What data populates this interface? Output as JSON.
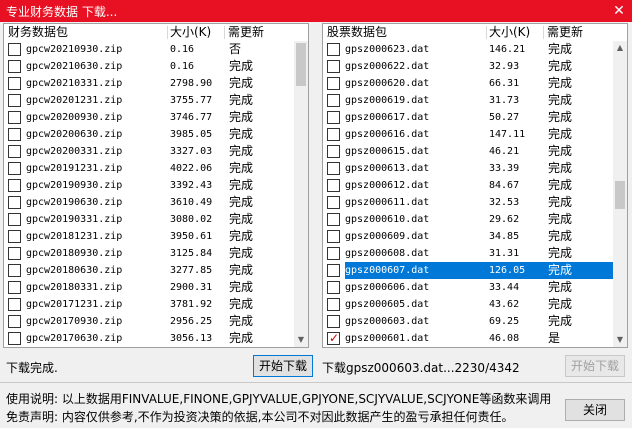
{
  "window": {
    "title": "专业财务数据 下载...",
    "close_glyph": "✕",
    "close_color": "#e81123"
  },
  "left_panel": {
    "columns": {
      "name": "财务数据包",
      "size": "大小(K)",
      "update": "需更新"
    },
    "rows": [
      {
        "checked": false,
        "name": "gpcw20210930.zip",
        "size": "0.16",
        "status": "否"
      },
      {
        "checked": false,
        "name": "gpcw20210630.zip",
        "size": "0.16",
        "status": "完成"
      },
      {
        "checked": false,
        "name": "gpcw20210331.zip",
        "size": "2798.90",
        "status": "完成"
      },
      {
        "checked": false,
        "name": "gpcw20201231.zip",
        "size": "3755.77",
        "status": "完成"
      },
      {
        "checked": false,
        "name": "gpcw20200930.zip",
        "size": "3746.77",
        "status": "完成"
      },
      {
        "checked": false,
        "name": "gpcw20200630.zip",
        "size": "3985.05",
        "status": "完成"
      },
      {
        "checked": false,
        "name": "gpcw20200331.zip",
        "size": "3327.03",
        "status": "完成"
      },
      {
        "checked": false,
        "name": "gpcw20191231.zip",
        "size": "4022.06",
        "status": "完成"
      },
      {
        "checked": false,
        "name": "gpcw20190930.zip",
        "size": "3392.43",
        "status": "完成"
      },
      {
        "checked": false,
        "name": "gpcw20190630.zip",
        "size": "3610.49",
        "status": "完成"
      },
      {
        "checked": false,
        "name": "gpcw20190331.zip",
        "size": "3080.02",
        "status": "完成"
      },
      {
        "checked": false,
        "name": "gpcw20181231.zip",
        "size": "3950.61",
        "status": "完成"
      },
      {
        "checked": false,
        "name": "gpcw20180930.zip",
        "size": "3125.84",
        "status": "完成"
      },
      {
        "checked": false,
        "name": "gpcw20180630.zip",
        "size": "3277.85",
        "status": "完成"
      },
      {
        "checked": false,
        "name": "gpcw20180331.zip",
        "size": "2900.31",
        "status": "完成"
      },
      {
        "checked": false,
        "name": "gpcw20171231.zip",
        "size": "3781.92",
        "status": "完成"
      },
      {
        "checked": false,
        "name": "gpcw20170930.zip",
        "size": "2956.25",
        "status": "完成"
      },
      {
        "checked": false,
        "name": "gpcw20170630.zip",
        "size": "3056.13",
        "status": "完成"
      }
    ]
  },
  "right_panel": {
    "columns": {
      "name": "股票数据包",
      "size": "大小(K)",
      "update": "需更新"
    },
    "rows": [
      {
        "checked": false,
        "name": "gpsz000623.dat",
        "size": "146.21",
        "status": "完成"
      },
      {
        "checked": false,
        "name": "gpsz000622.dat",
        "size": "32.93",
        "status": "完成"
      },
      {
        "checked": false,
        "name": "gpsz000620.dat",
        "size": "66.31",
        "status": "完成"
      },
      {
        "checked": false,
        "name": "gpsz000619.dat",
        "size": "31.73",
        "status": "完成"
      },
      {
        "checked": false,
        "name": "gpsz000617.dat",
        "size": "50.27",
        "status": "完成"
      },
      {
        "checked": false,
        "name": "gpsz000616.dat",
        "size": "147.11",
        "status": "完成"
      },
      {
        "checked": false,
        "name": "gpsz000615.dat",
        "size": "46.21",
        "status": "完成"
      },
      {
        "checked": false,
        "name": "gpsz000613.dat",
        "size": "33.39",
        "status": "完成"
      },
      {
        "checked": false,
        "name": "gpsz000612.dat",
        "size": "84.67",
        "status": "完成"
      },
      {
        "checked": false,
        "name": "gpsz000611.dat",
        "size": "32.53",
        "status": "完成"
      },
      {
        "checked": false,
        "name": "gpsz000610.dat",
        "size": "29.62",
        "status": "完成"
      },
      {
        "checked": false,
        "name": "gpsz000609.dat",
        "size": "34.85",
        "status": "完成"
      },
      {
        "checked": false,
        "name": "gpsz000608.dat",
        "size": "31.31",
        "status": "完成"
      },
      {
        "checked": false,
        "name": "gpsz000607.dat",
        "size": "126.05",
        "status": "完成",
        "selected": true
      },
      {
        "checked": false,
        "name": "gpsz000606.dat",
        "size": "33.44",
        "status": "完成"
      },
      {
        "checked": false,
        "name": "gpsz000605.dat",
        "size": "43.62",
        "status": "完成"
      },
      {
        "checked": false,
        "name": "gpsz000603.dat",
        "size": "69.25",
        "status": "完成"
      },
      {
        "checked": true,
        "name": "gpsz000601.dat",
        "size": "46.08",
        "status": "是"
      }
    ]
  },
  "left_status": "下载完成.",
  "left_button": "开始下载",
  "right_status": "下载gpsz000603.dat...2230/4342",
  "right_button": "开始下载",
  "usage_note": "使用说明: 以上数据用FINVALUE,FINONE,GPJYVALUE,GPJYONE,SCJYVALUE,SCJYONE等函数来调用",
  "disclaimer": "免责声明: 内容仅供参考,不作为投资决策的依据,本公司不对因此数据产生的盈亏承担任何责任。",
  "close_button": "关闭",
  "colors": {
    "selection": "#0078d7",
    "check": "#d00000"
  }
}
